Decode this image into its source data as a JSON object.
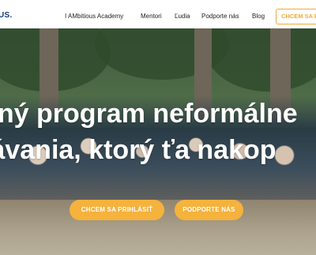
{
  "header": {
    "logo": "US.",
    "nav": [
      "I AMbitious Academy",
      "Mentori",
      "Ľudia",
      "Podporte nás",
      "Blog"
    ],
    "cta": "CHCEM SA PRI"
  },
  "hero": {
    "headline_line1": "čný program neformálne",
    "headline_line2": "lávania, ktorý ťa nakop",
    "primary_button": "CHCEM SA PRIHLÁSIŤ",
    "secondary_button": "PODPORTE NÁS"
  },
  "colors": {
    "accent": "#f5b23c",
    "cta_outline": "#f1a93a",
    "logo": "#123a72"
  }
}
